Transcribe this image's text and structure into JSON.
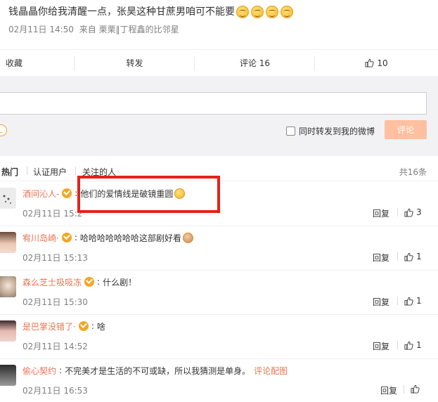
{
  "post": {
    "text": "钱晶晶你给我清醒一点，张昊这种甘蔗男咱可不能要",
    "emoji_count": 4,
    "date": "02月11日 14:50",
    "source": "来自 栗栗‖丁程鑫的比邻星"
  },
  "actions": {
    "favorite": "收藏",
    "forward": "转发",
    "comment": "评论 16",
    "like": "10"
  },
  "composer": {
    "forward_label": "同时转发到我的微博",
    "submit": "评论"
  },
  "filters": {
    "hot": "热门",
    "verified": "认证用户",
    "following": "关注的人",
    "total": "共16条"
  },
  "comments": [
    {
      "name": "酒间沁人-",
      "text": "他们的爱情线是破镜重圆",
      "time": "02月11日 15:2",
      "reply": "回复",
      "likes": "3",
      "avatar_color": "#d8d8d8"
    },
    {
      "name": "宥川岛崎·",
      "text": "哈哈哈哈哈哈哈这部剧好看",
      "time": "02月11日 15:13",
      "reply": "回复",
      "likes": "1",
      "avatar_color": "#c9a28a"
    },
    {
      "name": "森么芝士吸吸冻",
      "text": "什么剧！",
      "time": "02月11日 15:30",
      "reply": "回复",
      "likes": "1",
      "avatar_color": "#b8a898"
    },
    {
      "name": "是巴掌没错了·",
      "text": "啥",
      "time": "02月11日 14:52",
      "reply": "回复",
      "likes": "1",
      "avatar_color": "#d9a5a5"
    },
    {
      "name": "偷心契约",
      "text": "不完美才是生活的不可或缺，所以我猜测是单身。",
      "link": "评论配图",
      "time": "02月11日 16:53",
      "reply": "回复",
      "likes": "",
      "avatar_color": "#555555"
    }
  ],
  "colors": {
    "accent": "#eb7350",
    "highlight": "#e8201a",
    "button": "#ffc09f"
  }
}
